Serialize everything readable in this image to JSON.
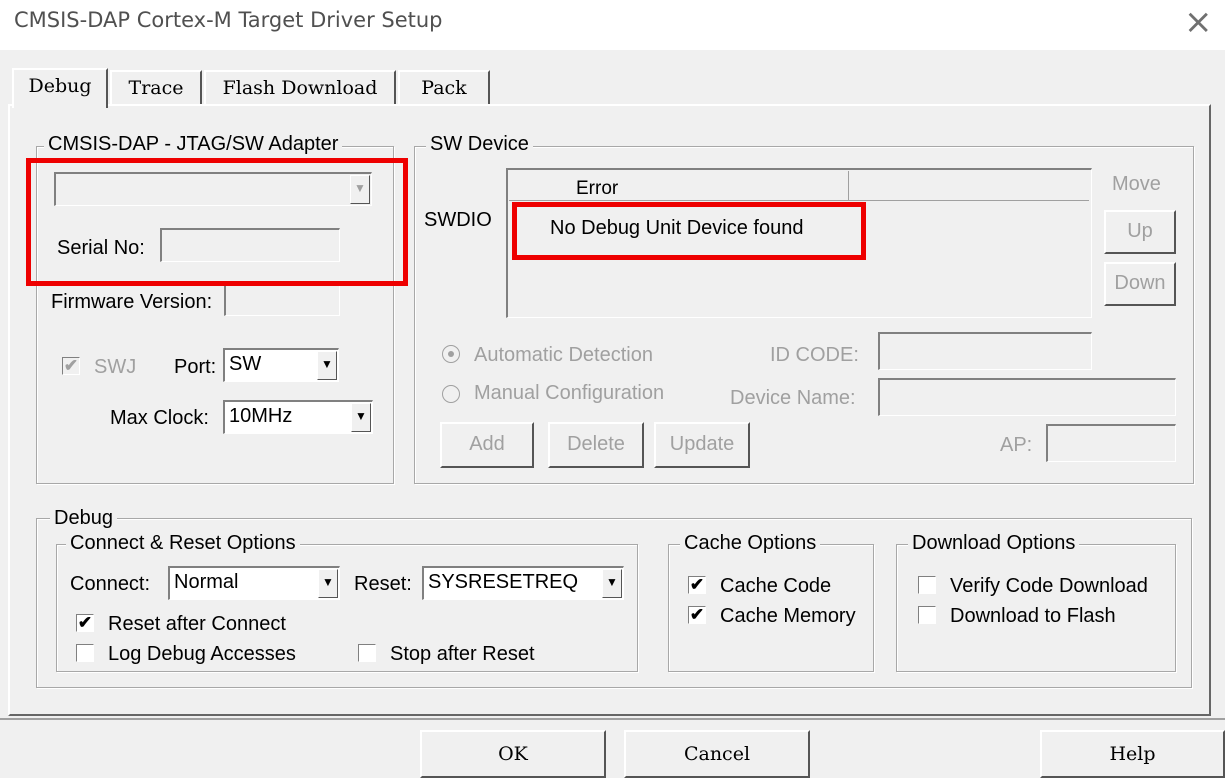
{
  "window": {
    "title": "CMSIS-DAP Cortex-M Target Driver Setup",
    "close_icon": "close-icon"
  },
  "tabs": [
    {
      "label": "Debug",
      "active": true
    },
    {
      "label": "Trace",
      "active": false
    },
    {
      "label": "Flash Download",
      "active": false
    },
    {
      "label": "Pack",
      "active": false
    }
  ],
  "adapter": {
    "group_label": "CMSIS-DAP - JTAG/SW Adapter",
    "adapter_select_value": "",
    "serial_label": "Serial No:",
    "serial_value": "",
    "firmware_label": "Firmware Version:",
    "firmware_value": "",
    "swj_label": "SWJ",
    "swj_checked": true,
    "port_label": "Port:",
    "port_value": "SW",
    "max_clock_label": "Max Clock:",
    "max_clock_value": "10MHz"
  },
  "sw_device": {
    "group_label": "SW Device",
    "swdio_label": "SWDIO",
    "table_headers": [
      "Error",
      ""
    ],
    "table_message": "No Debug Unit Device found",
    "move_label": "Move",
    "up_button": "Up",
    "down_button": "Down",
    "auto_detect_label": "Automatic Detection",
    "manual_config_label": "Manual Configuration",
    "id_code_label": "ID CODE:",
    "device_name_label": "Device Name:",
    "ap_label": "AP:",
    "add_button": "Add",
    "delete_button": "Delete",
    "update_button": "Update"
  },
  "debug": {
    "group_label": "Debug",
    "connect_reset": {
      "group_label": "Connect & Reset Options",
      "connect_label": "Connect:",
      "connect_value": "Normal",
      "reset_label": "Reset:",
      "reset_value": "SYSRESETREQ",
      "reset_after_connect_label": "Reset after Connect",
      "reset_after_connect_checked": true,
      "log_debug_label": "Log Debug Accesses",
      "log_debug_checked": false,
      "stop_after_reset_label": "Stop after Reset",
      "stop_after_reset_checked": false
    },
    "cache": {
      "group_label": "Cache Options",
      "cache_code_label": "Cache Code",
      "cache_code_checked": true,
      "cache_memory_label": "Cache Memory",
      "cache_memory_checked": true
    },
    "download": {
      "group_label": "Download Options",
      "verify_label": "Verify Code Download",
      "verify_checked": false,
      "flash_label": "Download to Flash",
      "flash_checked": false
    }
  },
  "footer": {
    "ok_button": "OK",
    "cancel_button": "Cancel",
    "help_button": "Help"
  },
  "colors": {
    "highlight_red": "#ee0000",
    "dialog_bg": "#f0f0f0",
    "disabled_text": "#a0a0a0"
  }
}
